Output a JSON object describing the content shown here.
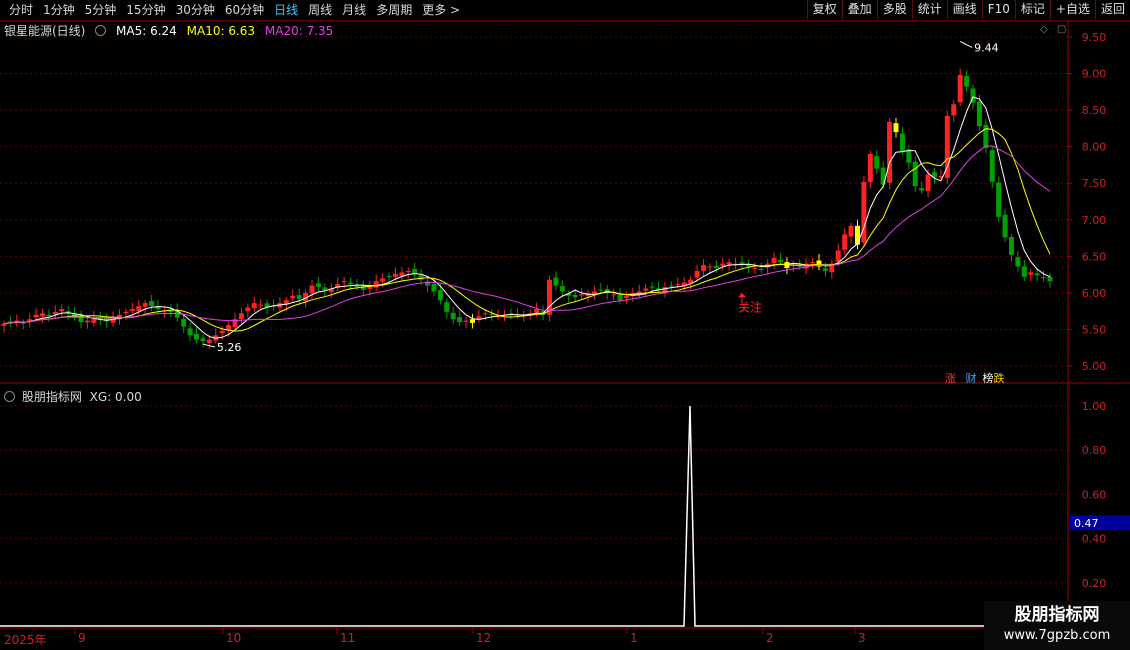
{
  "toolbar": {
    "periods": [
      "分时",
      "1分钟",
      "5分钟",
      "15分钟",
      "30分钟",
      "60分钟",
      "日线",
      "周线",
      "月线",
      "多周期",
      "更多 >"
    ],
    "active_period": "日线",
    "tools": [
      "复权",
      "叠加",
      "多股",
      "统计",
      "画线",
      "F10",
      "标记",
      "+自选",
      "返回"
    ]
  },
  "main_chart": {
    "stock_name": "银星能源(日线)",
    "ma5_label": "MA5: 6.24",
    "ma10_label": "MA10: 6.63",
    "ma20_label": "MA20: 7.35",
    "high_marker": "9.44",
    "low_marker": "5.26",
    "annotation": "关注",
    "yaxis_ticks": [
      "9.50",
      "9.00",
      "8.50",
      "8.00",
      "7.50",
      "7.00",
      "6.50",
      "6.00",
      "5.50",
      "5.00"
    ],
    "tags": [
      "涨",
      "财",
      "榜",
      "跌"
    ],
    "colors": {
      "up": "#ff2222",
      "down": "#00a000",
      "signal": "#ffff00",
      "ma5": "#ffffff",
      "ma10": "#ffff00",
      "ma20": "#e040e0"
    }
  },
  "indicator_panel": {
    "name": "股朋指标网",
    "xg_label": "XG: 0.00",
    "yaxis_ticks": [
      "1.00",
      "0.80",
      "0.60",
      "0.40",
      "0.20"
    ],
    "current_value": "0.47"
  },
  "xaxis": {
    "labels": [
      "2025年",
      "9",
      "10",
      "11",
      "12",
      "1",
      "2",
      "3"
    ]
  },
  "watermark": {
    "line1": "股朋指标网",
    "line2": "www.7gpzb.com"
  },
  "chart_data": {
    "type": "candlestick",
    "ylim": [
      4.85,
      9.6
    ],
    "candles_close": [
      5.58,
      5.6,
      5.62,
      5.59,
      5.64,
      5.7,
      5.72,
      5.68,
      5.74,
      5.78,
      5.72,
      5.66,
      5.6,
      5.62,
      5.66,
      5.64,
      5.61,
      5.66,
      5.7,
      5.74,
      5.78,
      5.82,
      5.86,
      5.82,
      5.78,
      5.76,
      5.74,
      5.66,
      5.54,
      5.42,
      5.36,
      5.34,
      5.36,
      5.42,
      5.48,
      5.56,
      5.64,
      5.72,
      5.8,
      5.86,
      5.84,
      5.8,
      5.82,
      5.86,
      5.9,
      5.96,
      5.92,
      6.0,
      6.1,
      6.08,
      6.04,
      6.06,
      6.12,
      6.16,
      6.12,
      6.08,
      6.04,
      6.1,
      6.16,
      6.2,
      6.22,
      6.26,
      6.28,
      6.3,
      6.26,
      6.18,
      6.1,
      6.02,
      5.9,
      5.74,
      5.64,
      5.6,
      5.62,
      5.64,
      5.68,
      5.72,
      5.7,
      5.68,
      5.7,
      5.72,
      5.7,
      5.69,
      5.72,
      5.78,
      5.7,
      6.18,
      6.1,
      6.02,
      5.96,
      5.94,
      5.98,
      6.0,
      6.02,
      6.04,
      6.0,
      5.98,
      5.9,
      5.96,
      6.0,
      6.02,
      6.06,
      6.08,
      6.04,
      6.08,
      6.1,
      6.12,
      6.14,
      6.18,
      6.3,
      6.38,
      6.36,
      6.34,
      6.4,
      6.42,
      6.4,
      6.38,
      6.36,
      6.34,
      6.32,
      6.4,
      6.48,
      6.42,
      6.34,
      6.38,
      6.36,
      6.4,
      6.42,
      6.36,
      6.3,
      6.4,
      6.58,
      6.8,
      6.92,
      6.66,
      7.52,
      7.9,
      7.7,
      7.48,
      8.34,
      8.2,
      7.94,
      7.78,
      7.46,
      7.4,
      7.62,
      7.58,
      7.6,
      8.42,
      8.58,
      8.98,
      8.82,
      8.6,
      8.28,
      7.98,
      7.52,
      7.04,
      6.76,
      6.52,
      6.36,
      6.22,
      6.28,
      6.24,
      6.2,
      6.16
    ],
    "signal_candles": [
      73,
      122,
      127,
      133,
      139
    ]
  }
}
